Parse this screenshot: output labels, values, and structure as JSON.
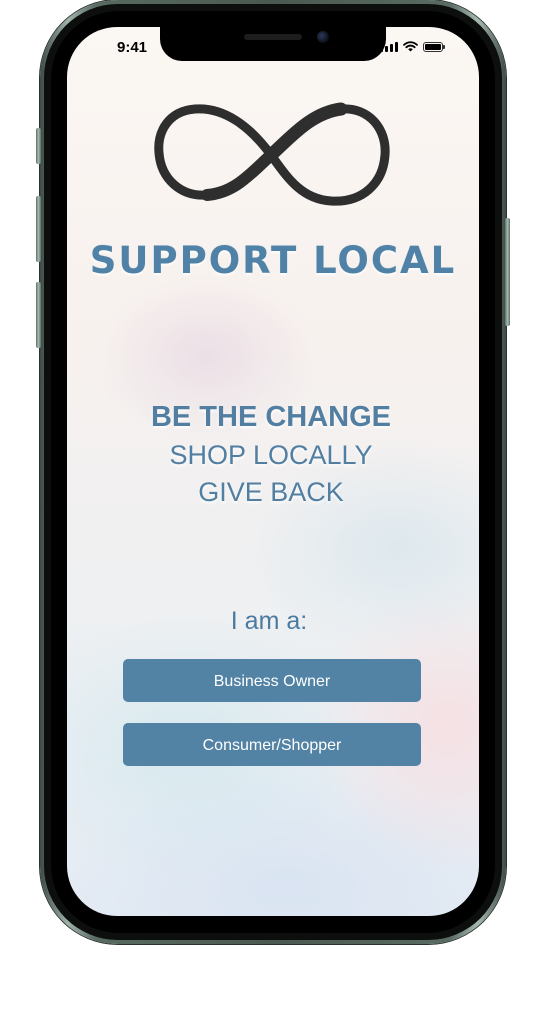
{
  "status_bar": {
    "time": "9:41",
    "icons": [
      "cellular-signal-icon",
      "wifi-icon",
      "battery-icon"
    ]
  },
  "app": {
    "logo_icon": "infinity-icon",
    "title": "SUPPORT LOCAL"
  },
  "taglines": {
    "line1": "BE THE CHANGE",
    "line2": "SHOP LOCALLY",
    "line3": "GIVE BACK"
  },
  "role_prompt": "I am a:",
  "role_buttons": {
    "business_owner": "Business Owner",
    "consumer_shopper": "Consumer/Shopper"
  },
  "colors": {
    "accent": "#5282a4",
    "title": "#4f82a6",
    "logo": "#2e2e2e",
    "phone_frame": "#4a5a52"
  }
}
